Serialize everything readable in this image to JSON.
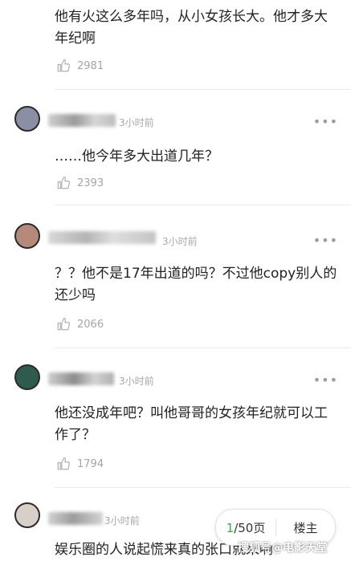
{
  "comments": [
    {
      "time": "",
      "text": "他有火这么多年吗，从小女孩长大。他才多大年纪啊",
      "likes": "2981"
    },
    {
      "time": "3小时前",
      "text": "……他今年多大出道几年？",
      "likes": "2393"
    },
    {
      "time": "3小时前",
      "text": "？？他不是17年出道的吗？不过他copy别人的还少吗",
      "likes": "2066"
    },
    {
      "time": "3小时前",
      "text": "他还没成年吧？叫他哥哥的女孩年纪就可以工作了？",
      "likes": "1794"
    },
    {
      "time": "3小时前",
      "text": "娱乐圈的人说起慌来真的张口就来啊",
      "likes": ""
    }
  ],
  "more_glyph": "•••",
  "pager": {
    "current": "1",
    "total": "/50页",
    "op_label": "楼主"
  },
  "watermark": "搜狐号@电影天堂",
  "colors": {
    "accent": "#3aa35a",
    "muted": "#a8a8a8",
    "divider": "#ebebeb"
  }
}
